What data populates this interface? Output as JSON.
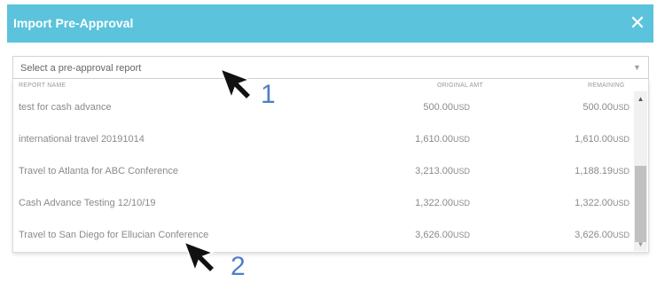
{
  "dialog": {
    "title": "Import Pre-Approval",
    "close_icon": "close-icon",
    "close_glyph": "✕"
  },
  "select": {
    "placeholder": "Select a pre-approval report",
    "arrow_icon": "chevron-down-icon",
    "arrow_glyph": "▼"
  },
  "columns": {
    "name": "REPORT NAME",
    "original": "ORIGINAL AMT",
    "remaining": "REMAINING"
  },
  "rows": [
    {
      "name": "test for cash advance",
      "original": "500.00",
      "remaining": "500.00",
      "currency": "USD"
    },
    {
      "name": "international travel 20191014",
      "original": "1,610.00",
      "remaining": "1,610.00",
      "currency": "USD"
    },
    {
      "name": "Travel to Atlanta for ABC Conference",
      "original": "3,213.00",
      "remaining": "1,188.19",
      "currency": "USD"
    },
    {
      "name": "Cash Advance Testing 12/10/19",
      "original": "1,322.00",
      "remaining": "1,322.00",
      "currency": "USD"
    },
    {
      "name": "Travel to San Diego for Ellucian Conference",
      "original": "3,626.00",
      "remaining": "3,626.00",
      "currency": "USD"
    }
  ],
  "scrollbar": {
    "up_glyph": "▲",
    "down_glyph": "▼"
  },
  "annotations": [
    {
      "label": "1",
      "icon": "arrow-cursor-icon"
    },
    {
      "label": "2",
      "icon": "arrow-cursor-icon"
    }
  ],
  "colors": {
    "header": "#5bc3dc",
    "annotation": "#4f7fc6"
  }
}
